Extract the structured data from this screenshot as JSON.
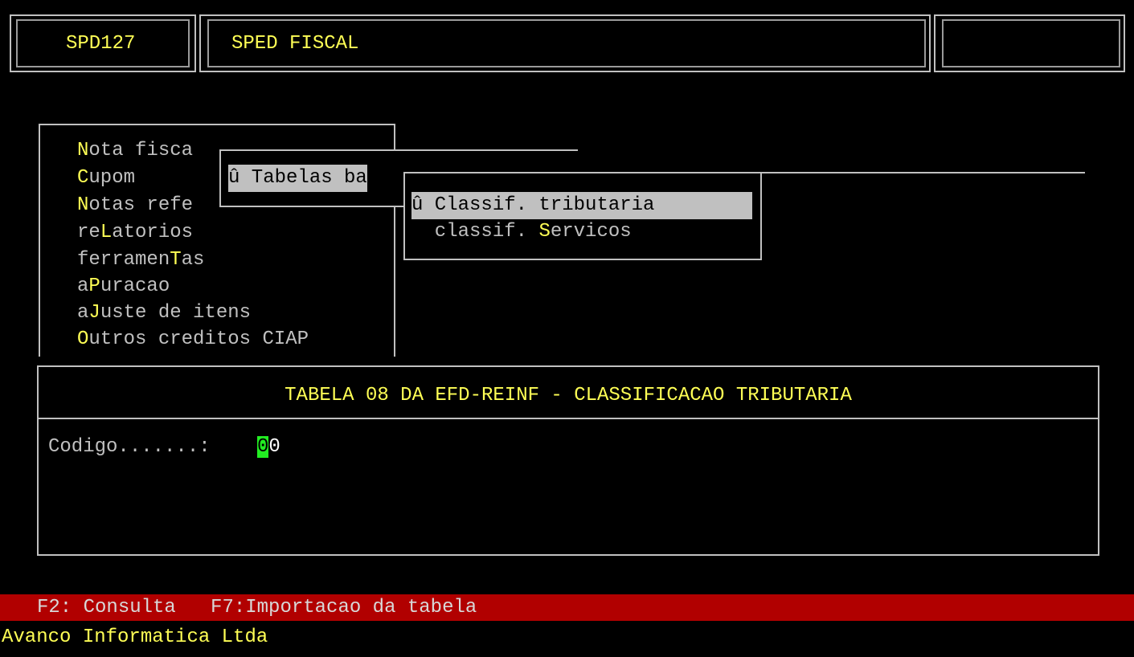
{
  "header": {
    "program_code": "SPD127",
    "module_title": "SPED FISCAL",
    "right_box": ""
  },
  "main_menu": {
    "items": [
      {
        "hotkey": "N",
        "rest": "ota fisca"
      },
      {
        "hotkey": "C",
        "rest": "upom"
      },
      {
        "hotkey": "N",
        "rest": "otas refe"
      },
      {
        "pre": "re",
        "hotkey": "L",
        "rest": "atorios"
      },
      {
        "pre": "ferramen",
        "hotkey": "T",
        "rest": "as"
      },
      {
        "pre": "a",
        "hotkey": "P",
        "rest": "uracao"
      },
      {
        "pre": "a",
        "hotkey": "J",
        "rest": "uste de itens"
      },
      {
        "hotkey": "O",
        "rest": "utros creditos CIAP"
      }
    ]
  },
  "submenu1": {
    "selected": "û Tabelas ba"
  },
  "submenu2": {
    "items": [
      {
        "text": "û Classif. tributaria"
      },
      {
        "pre": "  classif. ",
        "hotkey": "S",
        "rest": "ervicos"
      }
    ]
  },
  "form": {
    "title": "TABELA 08 DA EFD-REINF - CLASSIFICACAO TRIBUTARIA",
    "code_label": "Codigo.......:",
    "code_cursor_char": "0",
    "code_rest": "0"
  },
  "function_keys": "F2: Consulta   F7:Importacao da tabela",
  "footer": "Avanco Informatica Ltda",
  "colors": {
    "background": "#000000",
    "text": "#c0c0c0",
    "accent_yellow": "#ffff55",
    "status_bar": "#b10000",
    "cursor": "#22ee22",
    "highlight": "#c0c0c0"
  }
}
